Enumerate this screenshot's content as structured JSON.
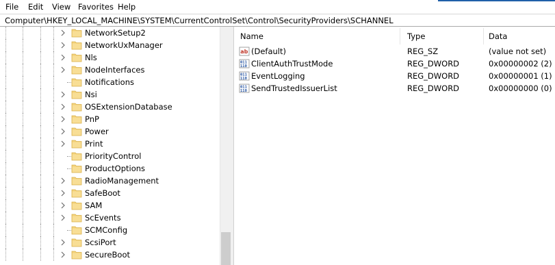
{
  "menu": {
    "items": [
      {
        "label": "File"
      },
      {
        "label": "Edit"
      },
      {
        "label": "View"
      },
      {
        "label": "Favorites"
      },
      {
        "label": "Help"
      }
    ]
  },
  "address": {
    "path": "Computer\\HKEY_LOCAL_MACHINE\\SYSTEM\\CurrentControlSet\\Control\\SecurityProviders\\SCHANNEL"
  },
  "tree": {
    "items": [
      {
        "label": "NetworkSetup2",
        "expandable": true
      },
      {
        "label": "NetworkUxManager",
        "expandable": true
      },
      {
        "label": "Nls",
        "expandable": true
      },
      {
        "label": "NodeInterfaces",
        "expandable": true
      },
      {
        "label": "Notifications",
        "expandable": false
      },
      {
        "label": "Nsi",
        "expandable": true
      },
      {
        "label": "OSExtensionDatabase",
        "expandable": true
      },
      {
        "label": "PnP",
        "expandable": true
      },
      {
        "label": "Power",
        "expandable": true
      },
      {
        "label": "Print",
        "expandable": true
      },
      {
        "label": "PriorityControl",
        "expandable": false
      },
      {
        "label": "ProductOptions",
        "expandable": false
      },
      {
        "label": "RadioManagement",
        "expandable": true
      },
      {
        "label": "SafeBoot",
        "expandable": true
      },
      {
        "label": "SAM",
        "expandable": true
      },
      {
        "label": "ScEvents",
        "expandable": true
      },
      {
        "label": "SCMConfig",
        "expandable": false
      },
      {
        "label": "ScsiPort",
        "expandable": true
      },
      {
        "label": "SecureBoot",
        "expandable": true
      }
    ]
  },
  "values": {
    "columns": {
      "name": "Name",
      "type": "Type",
      "data": "Data"
    },
    "rows": [
      {
        "icon": "string-value-icon",
        "name": "(Default)",
        "type": "REG_SZ",
        "data": "(value not set)"
      },
      {
        "icon": "binary-value-icon",
        "name": "ClientAuthTrustMode",
        "type": "REG_DWORD",
        "data": "0x00000002 (2)"
      },
      {
        "icon": "binary-value-icon",
        "name": "EventLogging",
        "type": "REG_DWORD",
        "data": "0x00000001 (1)"
      },
      {
        "icon": "binary-value-icon",
        "name": "SendTrustedIssuerList",
        "type": "REG_DWORD",
        "data": "0x00000000 (0)"
      }
    ]
  },
  "colors": {
    "folder": "#f3d27a",
    "folder_edge": "#d9b04b",
    "accent": "#1f5fa8"
  }
}
